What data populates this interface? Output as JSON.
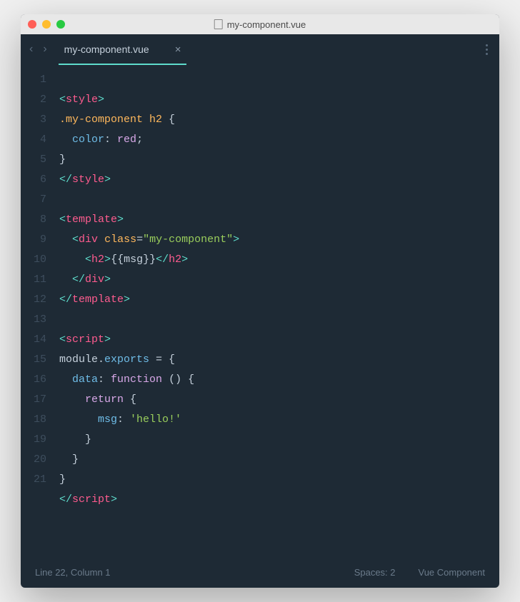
{
  "titlebar": {
    "filename": "my-component.vue"
  },
  "tab": {
    "name": "my-component.vue"
  },
  "lines": [
    "1",
    "2",
    "3",
    "4",
    "5",
    "6",
    "7",
    "8",
    "9",
    "10",
    "11",
    "12",
    "13",
    "14",
    "15",
    "16",
    "17",
    "18",
    "19",
    "20",
    "21"
  ],
  "code": {
    "l1_tag": "style",
    "l2_sel": ".my-component h2",
    "l3_prop": "color",
    "l3_val": "red",
    "l5_tag": "style",
    "l7_tag": "template",
    "l8_tag": "div",
    "l8_attr": "class",
    "l8_str": "\"my-component\"",
    "l9_tag": "h2",
    "l9_txt": "{{msg}}",
    "l10_tag": "div",
    "l11_tag": "template",
    "l13_tag": "script",
    "l14_obj": "module",
    "l14_prop": "exports",
    "l15_prop": "data",
    "l15_kw": "function",
    "l16_kw": "return",
    "l17_prop": "msg",
    "l17_str": "'hello!'",
    "l21_tag": "script"
  },
  "status": {
    "position": "Line 22, Column 1",
    "spaces": "Spaces: 2",
    "language": "Vue Component"
  }
}
